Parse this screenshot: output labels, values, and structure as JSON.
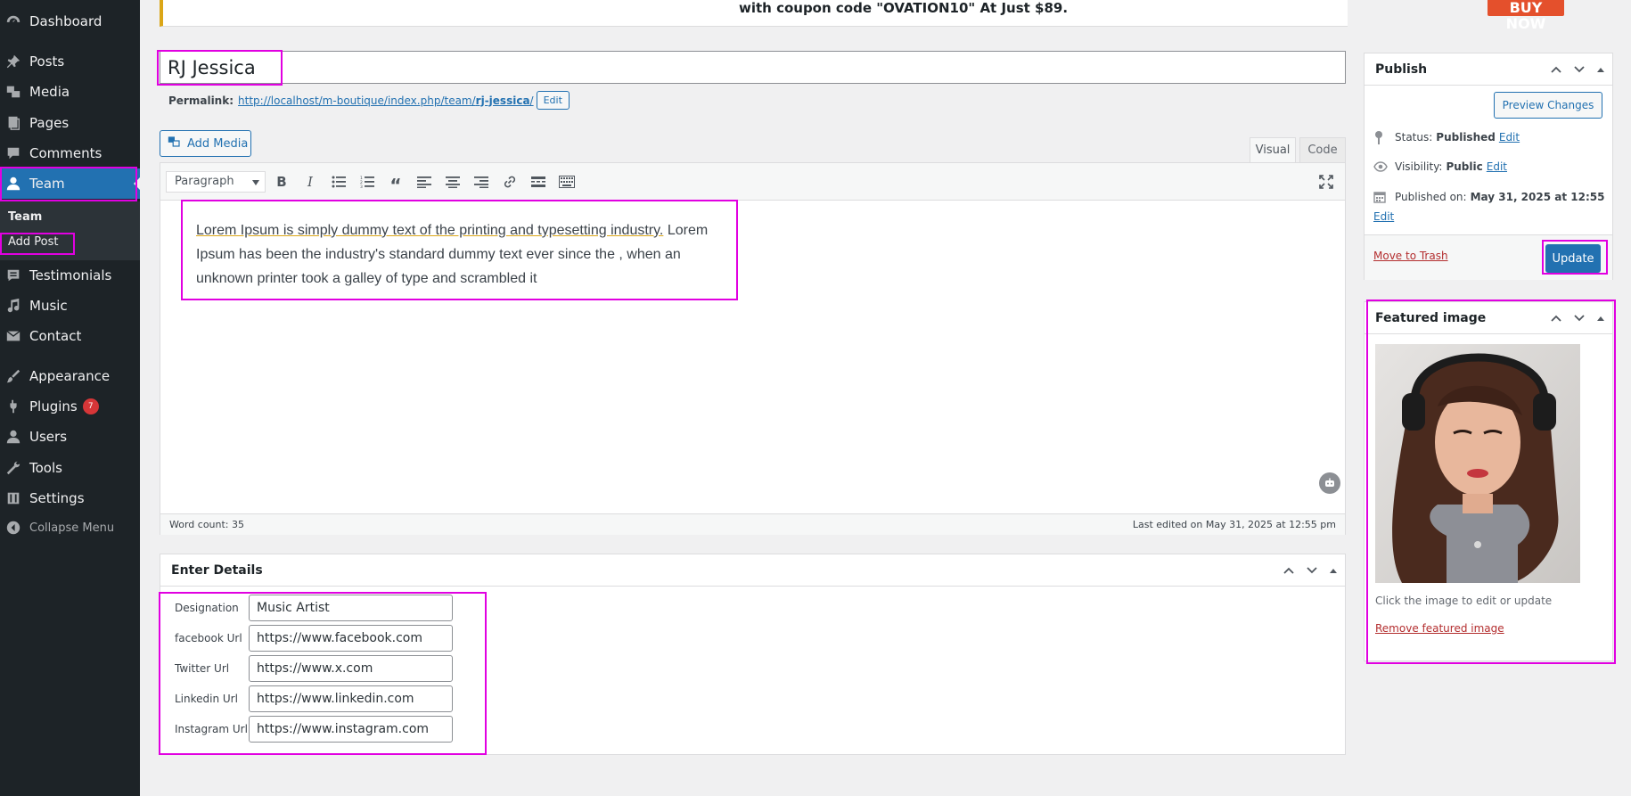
{
  "notice": {
    "text": "with coupon code \"OVATION10\" At Just $89.",
    "cta": "BUY NOW"
  },
  "sidebar": {
    "items": [
      {
        "label": "Dashboard",
        "icon": "dashboard-icon"
      },
      {
        "label": "Posts",
        "icon": "pin-icon"
      },
      {
        "label": "Media",
        "icon": "media-icon"
      },
      {
        "label": "Pages",
        "icon": "pages-icon"
      },
      {
        "label": "Comments",
        "icon": "comment-icon"
      },
      {
        "label": "Team",
        "icon": "user-icon"
      },
      {
        "label": "Testimonials",
        "icon": "testimonial-icon"
      },
      {
        "label": "Music",
        "icon": "music-icon"
      },
      {
        "label": "Contact",
        "icon": "mail-icon"
      },
      {
        "label": "Appearance",
        "icon": "brush-icon"
      },
      {
        "label": "Plugins",
        "icon": "plugin-icon",
        "badge": "7"
      },
      {
        "label": "Users",
        "icon": "users-icon"
      },
      {
        "label": "Tools",
        "icon": "wrench-icon"
      },
      {
        "label": "Settings",
        "icon": "settings-icon"
      }
    ],
    "submenu": {
      "heading": "Team",
      "add": "Add Post"
    },
    "collapse": "Collapse Menu"
  },
  "editor": {
    "title": "RJ Jessica",
    "permalink_label": "Permalink:",
    "permalink_url_prefix": "http://localhost/m-boutique/index.php/team/",
    "permalink_slug": "rj-jessica",
    "permalink_url_suffix": "/",
    "edit_label": "Edit",
    "add_media": "Add Media",
    "tab_visual": "Visual",
    "tab_code": "Code",
    "format": "Paragraph",
    "content_underlined": "Lorem Ipsum is simply dummy text of the printing and typesetting industry.",
    "content_rest": " Lorem Ipsum has been the industry's standard dummy text ever since the , when an unknown printer took a galley of type and scrambled it",
    "word_count": "Word count: 35",
    "last_edited": "Last edited on May 31, 2025 at 12:55 pm"
  },
  "details": {
    "title": "Enter Details",
    "fields": [
      {
        "label": "Designation",
        "value": "Music Artist"
      },
      {
        "label": "facebook Url",
        "value": "https://www.facebook.com"
      },
      {
        "label": "Twitter Url",
        "value": "https://www.x.com"
      },
      {
        "label": "Linkedin Url",
        "value": "https://www.linkedin.com"
      },
      {
        "label": "Instagram Url",
        "value": "https://www.instagram.com"
      }
    ]
  },
  "publish": {
    "title": "Publish",
    "preview": "Preview Changes",
    "status_label": "Status:",
    "status_value": "Published",
    "visibility_label": "Visibility:",
    "visibility_value": "Public",
    "published_label": "Published on:",
    "published_value": "May 31, 2025 at 12:55",
    "edit": "Edit",
    "trash": "Move to Trash",
    "update": "Update"
  },
  "featured": {
    "title": "Featured image",
    "hint": "Click the image to edit or update",
    "remove": "Remove featured image"
  },
  "colors": {
    "accent": "#2271b1",
    "sidebar": "#1d2327",
    "highlight": "#e100e1",
    "danger": "#b32d2e"
  }
}
